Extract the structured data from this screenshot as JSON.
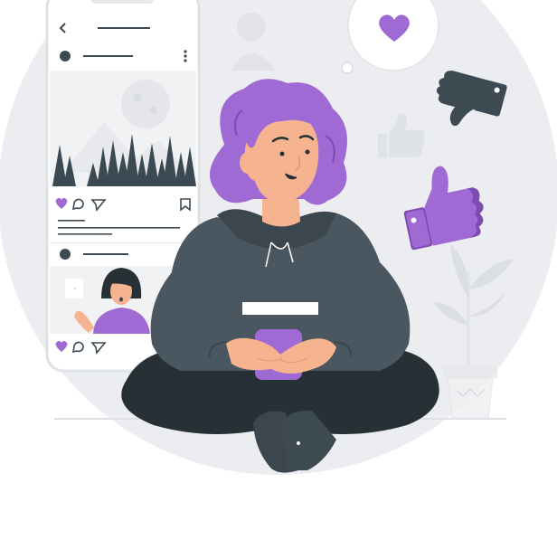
{
  "illustration": {
    "subject": "person-sitting-using-phone-social-media",
    "colors": {
      "page_bg": "#ffffff",
      "backdrop": "#ebedf0",
      "accent_purple": "#a06ad4",
      "purple_dark": "#7e4bb0",
      "hoodie": "#4a5760",
      "hoodie_dark": "#3b464e",
      "pants": "#263035",
      "skin": "#f6b38f",
      "dark_icon": "#3d4a52",
      "faded": "#d8dbdf",
      "phone_frame": "#dfe2e5"
    },
    "icons": [
      "heart-icon",
      "thumbs-down-icon",
      "thumbs-up-icon",
      "comment-icon",
      "send-icon",
      "bookmark-icon",
      "back-arrow-icon",
      "more-icon"
    ]
  }
}
